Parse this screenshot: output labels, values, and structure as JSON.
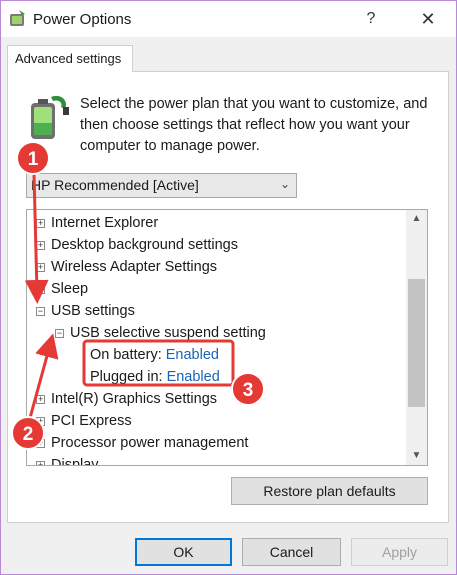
{
  "window": {
    "title": "Power Options",
    "help_label": "?",
    "close_label": "✕"
  },
  "tab": {
    "label": "Advanced settings"
  },
  "intro": {
    "text": "Select the power plan that you want to customize, and then choose settings that reflect how you want your computer to manage power."
  },
  "plan": {
    "selected": "HP Recommended [Active]"
  },
  "tree": {
    "items": [
      {
        "label": "Internet Explorer",
        "expander": "+"
      },
      {
        "label": "Desktop background settings",
        "expander": "+"
      },
      {
        "label": "Wireless Adapter Settings",
        "expander": "+"
      },
      {
        "label": "Sleep",
        "expander": "+"
      },
      {
        "label": "USB settings",
        "expander": "−"
      },
      {
        "label": "USB selective suspend setting",
        "expander": "−"
      },
      {
        "label": "On battery:",
        "value": "Enabled"
      },
      {
        "label": "Plugged in:",
        "value": "Enabled"
      },
      {
        "label": "Intel(R) Graphics Settings",
        "expander": "+"
      },
      {
        "label": "PCI Express",
        "expander": "+"
      },
      {
        "label": "Processor power management",
        "expander": "+"
      },
      {
        "label": "Display",
        "expander": "+"
      }
    ]
  },
  "buttons": {
    "restore": "Restore plan defaults",
    "ok": "OK",
    "cancel": "Cancel",
    "apply": "Apply"
  },
  "annotations": {
    "markers": [
      "1",
      "2",
      "3"
    ],
    "color": "#e53935"
  },
  "icons": {
    "app": "power-options-icon",
    "battery": "battery-plug-icon",
    "expand": "plus-box-icon",
    "collapse": "minus-box-icon"
  }
}
